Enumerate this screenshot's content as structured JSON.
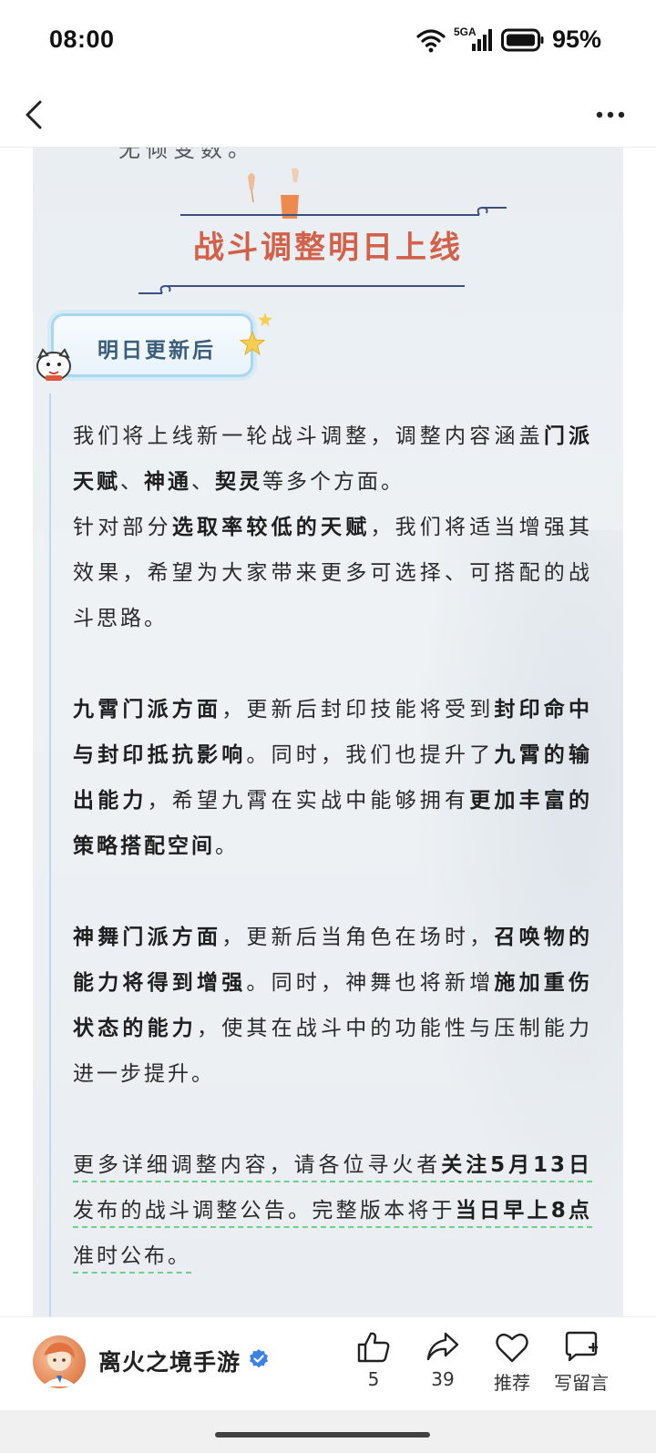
{
  "status_bar": {
    "time": "08:00",
    "network": "5GA",
    "battery": "95%"
  },
  "nav": {
    "back_icon": "chevron-left-icon",
    "more_icon": "more-horizontal-icon"
  },
  "article": {
    "cutoff_text": "无倾变数。",
    "section_title": "战斗调整明日上线",
    "badge_label": "明日更新后",
    "paragraphs": {
      "p1": {
        "t1": "我们将上线新一轮战斗调整，调整内容涵盖",
        "b1": "门派天赋",
        "t2": "、",
        "b2": "神通",
        "t3": "、",
        "b3": "契灵",
        "t4": "等多个方面。"
      },
      "p2": {
        "t1": "针对部分",
        "b1": "选取率较低的天赋",
        "t2": "，我们将适当增强其效果，希望为大家带来更多可选择、可搭配的战斗思路。"
      },
      "p3": {
        "b1": "九霄门派方面",
        "t1": "，更新后封印技能将受到",
        "b2": "封印命中与封印抵抗影响",
        "t2": "。同时，我们也提升了",
        "b3": "九霄的输出能力",
        "t3": "，希望九霄在实战中能够拥有",
        "b4": "更加丰富的策略搭配空间",
        "t4": "。"
      },
      "p4": {
        "b1": "神舞门派方面",
        "t1": "，更新后当角色在场时，",
        "b2": "召唤物的能力将得到增强",
        "t2": "。同时，神舞也将新增",
        "b3": "施加重伤状态的能力",
        "t3": "，使其在战斗中的功能性与压制能力进一步提升。"
      },
      "p5": {
        "t1": "更多详细调整内容，请各位寻火者",
        "b1": "关注5月13日",
        "t2": "发布的战斗调整公告。完整版本将于",
        "b2": "当日早上8点",
        "t3": "准时公布。"
      }
    }
  },
  "bottom_bar": {
    "account_name": "离火之境手游",
    "like_count": "5",
    "share_count": "39",
    "recommend_label": "推荐",
    "comment_label": "写留言"
  },
  "colors": {
    "title_accent": "#d3614a",
    "badge_border": "#a9d7f0",
    "verified_blue": "#3b82e6",
    "underline_green": "#6ecf88"
  }
}
